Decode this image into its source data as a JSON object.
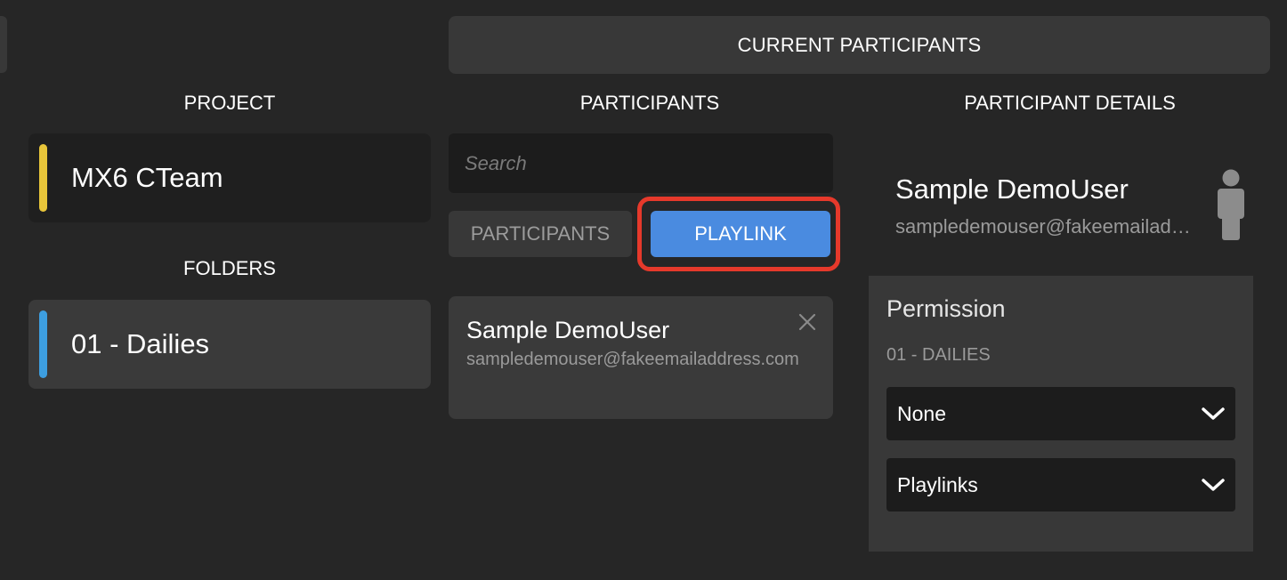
{
  "top_tab": {
    "label": "CURRENT PARTICIPANTS"
  },
  "project_column": {
    "heading": "PROJECT",
    "project": {
      "name": "MX6 CTeam",
      "color": "#e8c53a"
    },
    "folders_heading": "FOLDERS",
    "folder": {
      "name": "01 - Dailies",
      "color": "#3d9ee0"
    }
  },
  "participants_column": {
    "heading": "PARTICIPANTS",
    "search": {
      "placeholder": "Search",
      "value": ""
    },
    "segments": {
      "participants_label": "PARTICIPANTS",
      "playlink_label": "PLAYLINK",
      "active": "PLAYLINK"
    },
    "list": [
      {
        "name": "Sample DemoUser",
        "email": "sampledemouser@fakeemailaddress.com"
      }
    ]
  },
  "details_column": {
    "heading": "PARTICIPANT DETAILS",
    "name": "Sample DemoUser",
    "email": "sampledemouser@fakeemailaddress.com",
    "permission": {
      "title": "Permission",
      "folder_label": "01 - DAILIES",
      "selects": [
        {
          "value": "None"
        },
        {
          "value": "Playlinks"
        }
      ]
    }
  },
  "colors": {
    "accent": "#4a8be0",
    "highlight": "#e6392b",
    "background": "#262626"
  }
}
